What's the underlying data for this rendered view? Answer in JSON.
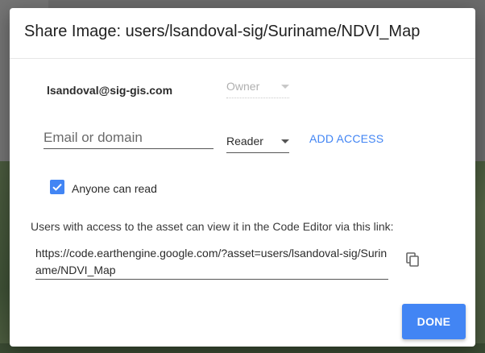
{
  "dialog": {
    "title": "Share Image: users/lsandoval-sig/Suriname/NDVI_Map",
    "owner": {
      "email": "lsandoval@sig-gis.com",
      "role": "Owner"
    },
    "add": {
      "placeholder": "Email or domain",
      "role": "Reader",
      "action_label": "ADD ACCESS"
    },
    "public_read": {
      "label": "Anyone can read",
      "checked": true
    },
    "link": {
      "info": "Users with access to the asset can view it in the Code Editor via this link:",
      "url": "https://code.earthengine.google.com/?asset=users/lsandoval-sig/Suriname/NDVI_Map"
    },
    "done_label": "DONE"
  },
  "colors": {
    "accent": "#4285f4",
    "overlay": "#6b6b6b"
  },
  "icons": {
    "copy": "copy-icon",
    "checkbox": "checkbox-checked-icon",
    "dropdown": "caret-down-icon"
  }
}
